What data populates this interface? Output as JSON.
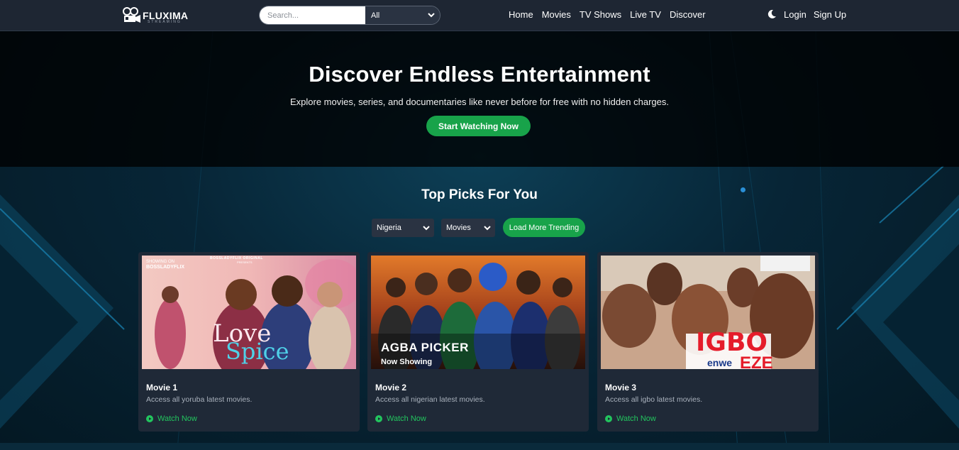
{
  "brand": {
    "name": "FLUXIMA",
    "tagline": "STREAMING"
  },
  "search": {
    "placeholder": "Search...",
    "category": "All"
  },
  "nav": {
    "links": [
      "Home",
      "Movies",
      "TV Shows",
      "Live TV",
      "Discover"
    ]
  },
  "auth": {
    "login": "Login",
    "signup": "Sign Up"
  },
  "hero": {
    "title": "Discover Endless Entertainment",
    "subtitle": "Explore movies, series, and documentaries like never before for free with no hidden charges.",
    "cta": "Start Watching Now"
  },
  "top_picks": {
    "title": "Top Picks For You",
    "country": "Nigeria",
    "type": "Movies",
    "load_more": "Load More Trending"
  },
  "cards": [
    {
      "title": "Movie 1",
      "desc": "Access all yoruba latest movies.",
      "action": "Watch Now",
      "poster": {
        "brand_line": "BOSSLADYFLIX ORIGINAL",
        "presents": "PRESENTS",
        "showing_on": "SHOWING ON",
        "channel": "BOSSLADYFLIX",
        "title_1": "Love",
        "title_2": "Spice"
      }
    },
    {
      "title": "Movie 2",
      "desc": "Access all nigerian latest movies.",
      "action": "Watch Now",
      "poster": {
        "title_1": "AGBA PICKER",
        "title_2": "Now Showing"
      }
    },
    {
      "title": "Movie 3",
      "desc": "Access all igbo latest movies.",
      "action": "Watch Now",
      "poster": {
        "title_1": "IGBO",
        "title_2": "enwe",
        "title_3": "EZE"
      }
    }
  ],
  "colors": {
    "accent": "#18a34a",
    "link": "#22c55e",
    "nav_bg": "#1e2633",
    "card_bg": "#1f2937"
  }
}
